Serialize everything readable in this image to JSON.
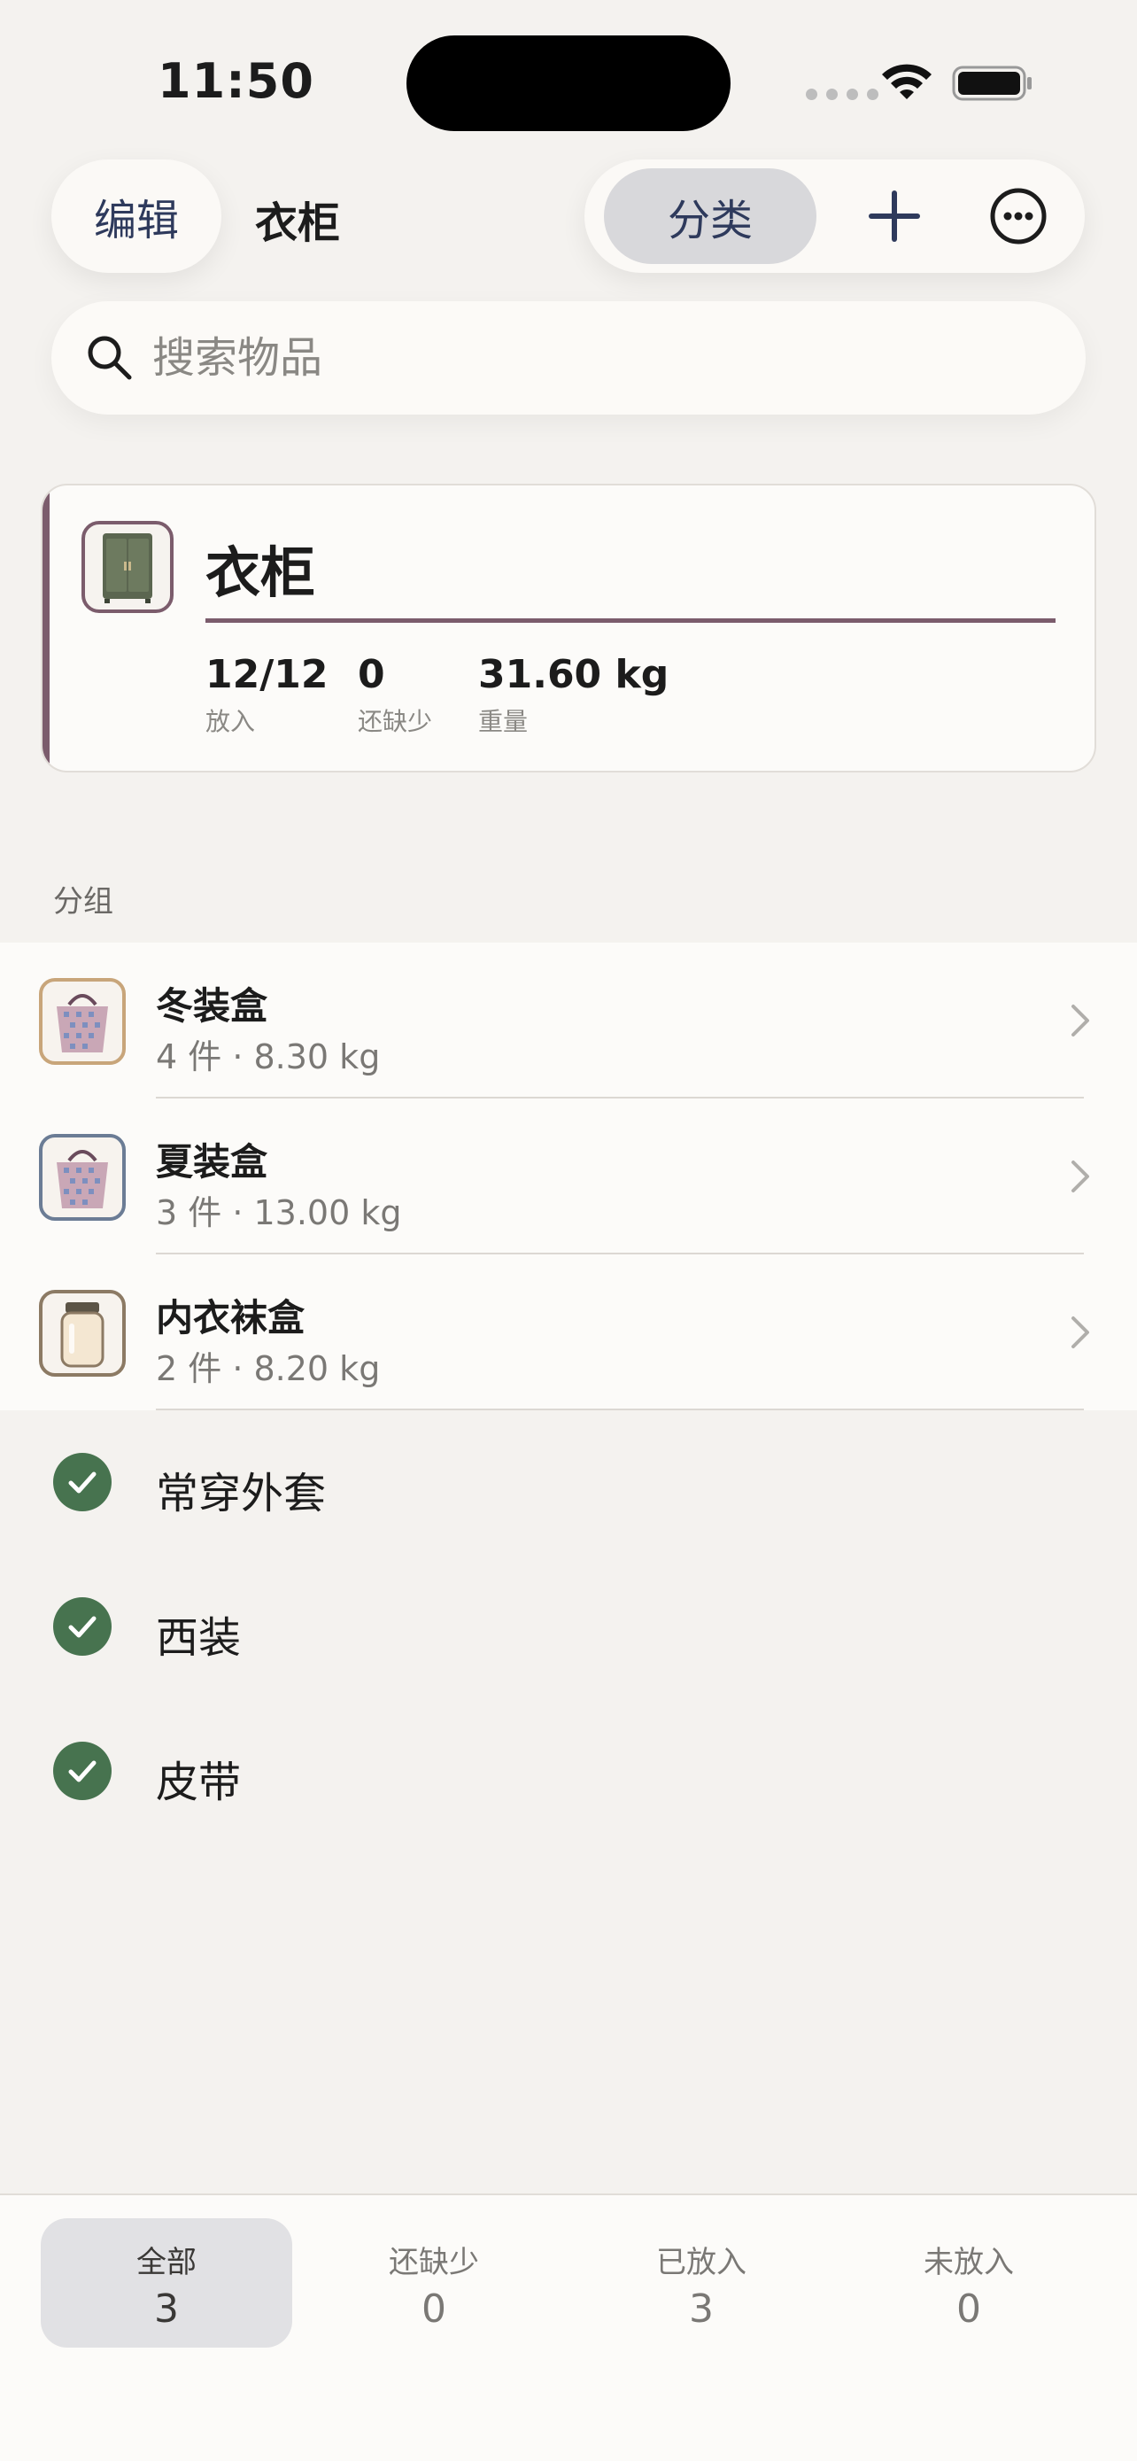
{
  "status_bar": {
    "time": "11:50"
  },
  "header": {
    "edit_label": "编辑",
    "title": "衣柜",
    "segment_label": "分类"
  },
  "search": {
    "placeholder": "搜索物品"
  },
  "summary": {
    "title": "衣柜",
    "stats": [
      {
        "value": "12/12",
        "label": "放入"
      },
      {
        "value": "0",
        "label": "还缺少"
      },
      {
        "value": "31.60 kg",
        "label": "重量"
      }
    ]
  },
  "groups": {
    "header": "分组",
    "items": [
      {
        "name": "冬装盒",
        "detail": "4 件 · 8.30 kg",
        "icon": "tote-bag-icon",
        "border_color": "#c8a57a"
      },
      {
        "name": "夏装盒",
        "detail": "3 件 · 13.00 kg",
        "icon": "tote-bag-icon",
        "border_color": "#6b7c95"
      },
      {
        "name": "内衣袜盒",
        "detail": "2 件 · 8.20 kg",
        "icon": "jar-icon",
        "border_color": "#8c7a64"
      }
    ]
  },
  "checked_items": [
    {
      "label": "常穿外套"
    },
    {
      "label": "西装"
    },
    {
      "label": "皮带"
    }
  ],
  "tabs": [
    {
      "label": "全部",
      "count": "3"
    },
    {
      "label": "还缺少",
      "count": "0"
    },
    {
      "label": "已放入",
      "count": "3"
    },
    {
      "label": "未放入",
      "count": "0"
    }
  ],
  "colors": {
    "accent": "#7b5c6c",
    "check_green": "#47734f",
    "nav_blue": "#2e3a5c"
  }
}
